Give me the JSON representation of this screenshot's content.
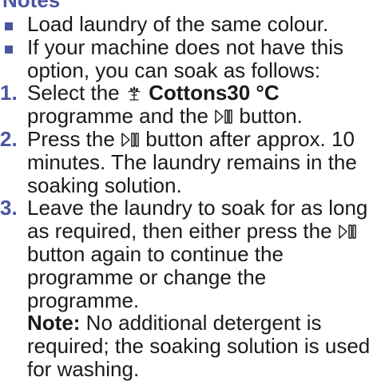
{
  "notes": {
    "heading": "Notes",
    "bullets": [
      "Load laundry of the same colour.",
      "If your machine does not have this option, you can soak as follows:"
    ],
    "steps": [
      {
        "num": "1.",
        "p1": "Select the ",
        "bold": "Cottons30 °C",
        "p2": "programme and the ",
        "p3": " button."
      },
      {
        "num": "2.",
        "p1": "Press the ",
        "p2": " button after approx. 10 minutes. The laundry remains in the soaking solution."
      },
      {
        "num": "3.",
        "p1": "Leave the laundry to soak for as long as required, then either press the ",
        "p2": "button again to continue the programme or change the programme.",
        "note_label": "Note:",
        "note_text": "No additional detergent is required; the soaking solution is used for washing."
      }
    ]
  },
  "icons": {
    "cottons": "cottons-programme-icon",
    "start_pause": "start-pause-icon"
  },
  "colors": {
    "accent": "#4a55a0",
    "text": "#1a1a1a"
  }
}
